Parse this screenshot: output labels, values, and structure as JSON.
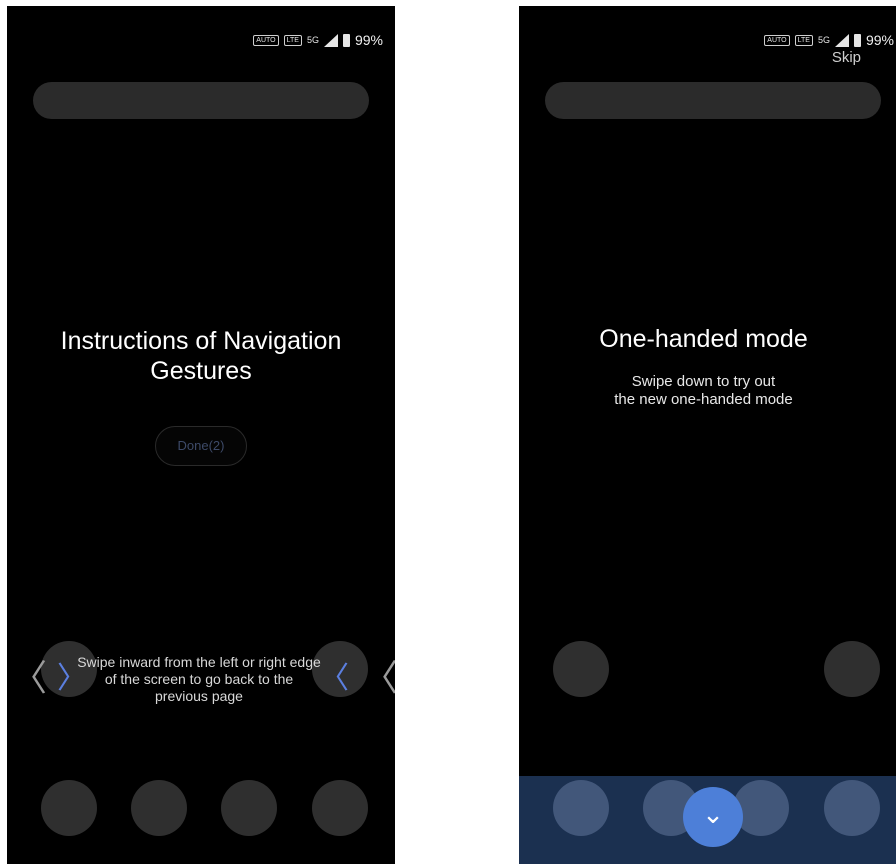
{
  "status_bar": {
    "mini_badge_1": "AUTO",
    "mini_badge_2": "LTE",
    "network": "5G",
    "battery": "99%"
  },
  "left_screen": {
    "title": "Instructions of Navigation Gestures",
    "done_button": "Done(2)",
    "hint": "Swipe inward from the left or right edge of the screen to go back to the previous page",
    "edge_left_chevron": "〈",
    "edge_right_chevron": "〈",
    "inner_left_chevron": "〉",
    "inner_right_chevron": "〈"
  },
  "right_screen": {
    "skip_label": "Skip",
    "title": "One-handed mode",
    "subtitle_line1": "Swipe down to try out",
    "subtitle_line2": "the new one-handed mode",
    "down_chevron": "⌄"
  },
  "colors": {
    "screen_bg": "#000000",
    "circle": "#2f2f2f",
    "accent_blue": "#4d7fd8",
    "bottom_band": "#1b3050"
  }
}
